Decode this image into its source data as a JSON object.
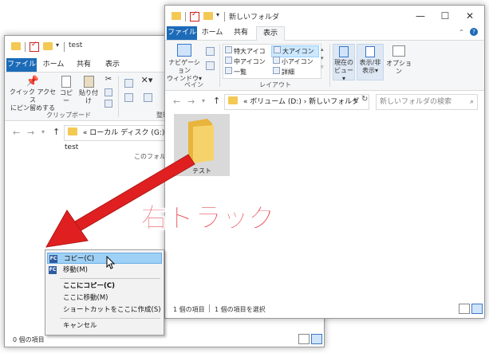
{
  "back_window": {
    "title": "test",
    "tabs": [
      "ファイル",
      "ホーム",
      "共有",
      "表示"
    ],
    "ribbon": {
      "pin_label": "クイック アクセス\nにピン留めする",
      "copy_label": "コピー",
      "paste_label": "貼り付け",
      "group_clipboard": "クリップボード",
      "group_organize": "整理"
    },
    "address": "ローカル ディスク (G:) › test",
    "address_prefix": "«",
    "empty_text": "このフォルダー",
    "status": "0 個の項目"
  },
  "front_window": {
    "title": "新しいフォルダ",
    "tabs": [
      "ファイル",
      "ホーム",
      "共有",
      "表示"
    ],
    "ribbon": {
      "nav_pane_label": "ナビゲーション\nウィンドウ▾",
      "group_pane": "ペイン",
      "layout_items": [
        "特大アイコン",
        "大アイコン",
        "中アイコン",
        "小アイコン",
        "一覧",
        "詳細"
      ],
      "group_layout": "レイアウト",
      "current_view_label": "現在の\nビュー▾",
      "show_hide_label": "表示/非\n表示▾",
      "options_label": "オプション"
    },
    "address_prefix": "«",
    "address": "ボリューム (D:) › 新しいフォルダ",
    "search_placeholder": "新しいフォルダの検索",
    "folder_name": "テスト",
    "status_items": "1 個の項目",
    "status_selected": "1 個の項目を選択"
  },
  "annotation": {
    "text": "右ドラッグ",
    "arrow_color": "#e02020",
    "text_color": "#e02030"
  },
  "context_menu": {
    "items": [
      {
        "label": "コピー(C)",
        "icon": "fastcopy-icon",
        "highlight": true
      },
      {
        "label": "移動(M)",
        "icon": "fastcopy-icon",
        "highlight": false
      },
      {
        "label": "ここにコピー(C)",
        "bold": true
      },
      {
        "label": "ここに移動(M)"
      },
      {
        "label": "ショートカットをここに作成(S)"
      },
      {
        "label": "キャンセル"
      }
    ]
  }
}
